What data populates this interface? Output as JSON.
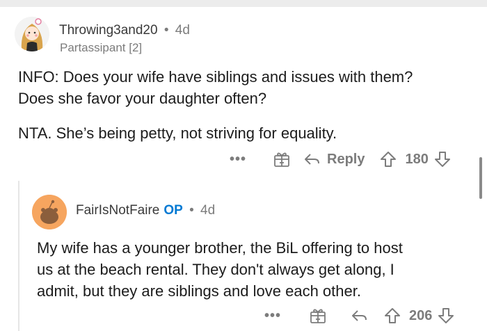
{
  "comment1": {
    "username": "Throwing3and20",
    "separator": "•",
    "age": "4d",
    "flair": "Partassipant [2]",
    "lines": [
      "INFO: Does your wife have siblings and issues with them?",
      "Does she favor your daughter often?",
      "NTA. She’s being petty, not striving for equality."
    ],
    "actions": {
      "more": "•••",
      "reply_label": "Reply",
      "score": "180"
    }
  },
  "comment2": {
    "username": "FairIsNotFaire",
    "op_badge": "OP",
    "separator": "•",
    "age": "4d",
    "lines": [
      "My wife has a younger brother, the BiL offering to host",
      "us at the beach rental. They don't always get along, I",
      "admit, but they are siblings and love each other."
    ],
    "actions": {
      "more": "•••",
      "score": "206"
    }
  },
  "icons": {
    "more": "more-options-icon",
    "award": "gift-award-icon",
    "reply": "reply-arrow-icon",
    "upvote": "upvote-arrow-icon",
    "downvote": "downvote-arrow-icon"
  },
  "colors": {
    "op_badge": "#0079d3",
    "meta_gray": "#7c7c7c",
    "avatar2_bg": "#f6a55f"
  }
}
